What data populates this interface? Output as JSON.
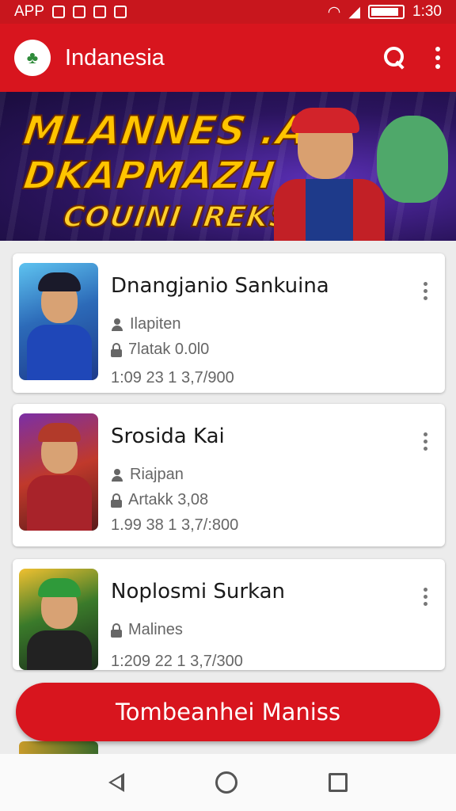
{
  "status_bar": {
    "left_text": "APP",
    "time": "1:30",
    "battery_level": 0.9
  },
  "app_bar": {
    "title": "Indanesia",
    "logo_icon": "app-logo-icon",
    "search_icon": "search-icon",
    "menu_icon": "more-vert-icon"
  },
  "banner": {
    "line1": "MLANNES .A",
    "line2": "DKAPMAZH",
    "line3": "COUINI IREKS"
  },
  "items": [
    {
      "title": "Dnangjanio Sankuina",
      "meta1": "Ilapiten",
      "meta1_icon": "person-icon",
      "meta2": "7latak 0.0l0",
      "meta2_icon": "lock-icon",
      "stats": "1:09 23 1 3,7/900"
    },
    {
      "title": "Srosida Kai",
      "meta1": "Riajpan",
      "meta1_icon": "person-icon",
      "meta2": "Artakk 3,08",
      "meta2_icon": "lock-icon",
      "stats": "1.99 38 1 3,7/:800"
    },
    {
      "title": "Noplosmi Surkan",
      "meta1": "Malines",
      "meta1_icon": "lock-icon",
      "stats": "1:209 22 1 3,7/300"
    }
  ],
  "cta": {
    "label": "Tombeanhei Maniss"
  },
  "nav": {
    "back_icon": "back-icon",
    "home_icon": "home-icon",
    "recent_icon": "recent-apps-icon"
  },
  "colors": {
    "primary": "#d8151e",
    "status_bar": "#c8161d",
    "banner_title": "#ffc400"
  }
}
